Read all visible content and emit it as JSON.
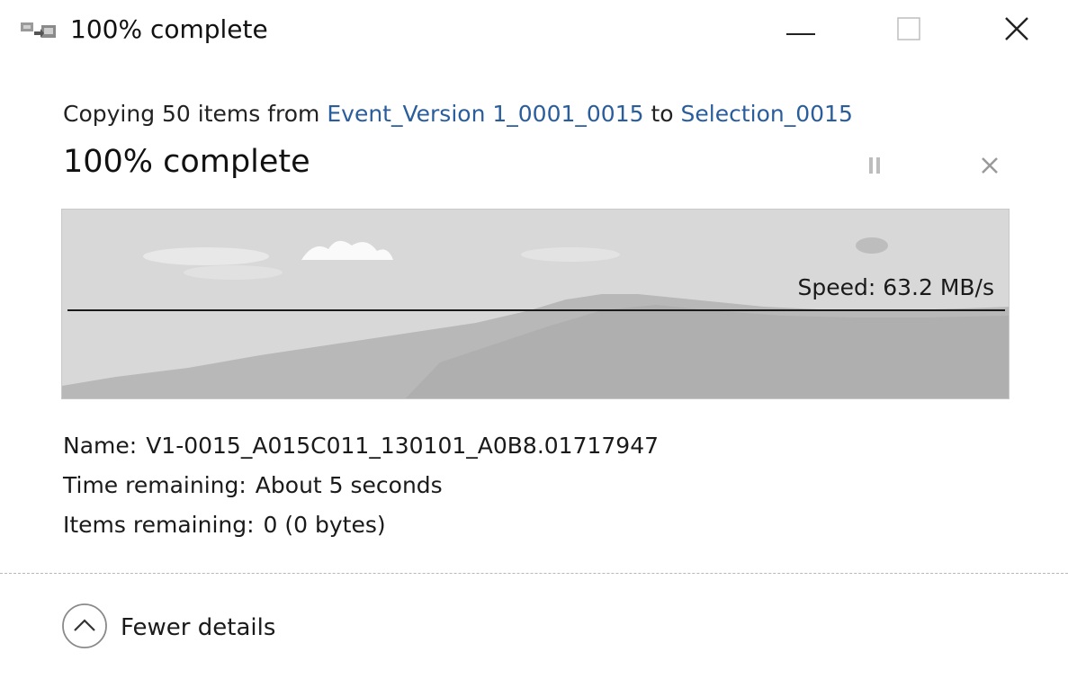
{
  "window": {
    "title": "100% complete",
    "icon": "copy-files-icon",
    "controls": {
      "minimize": "minimize-icon",
      "maximize": "maximize-icon",
      "close": "close-icon"
    }
  },
  "operation": {
    "prefix": "Copying 50 items from ",
    "source": "Event_Version 1_0001_0015",
    "mid": " to ",
    "destination": "Selection_0015",
    "status": "100% complete",
    "progress_fraction": 1.0,
    "pause_icon": "pause-icon",
    "cancel_icon": "close-icon"
  },
  "graph": {
    "speed": "Speed: 63.2 MB/s",
    "fill_color": "#b8b8b8",
    "background_color": "#d6d6d6"
  },
  "details": {
    "name_label": "Name:",
    "name_value": "V1-0015_A015C011_130101_A0B8.01717947",
    "time_label": "Time remaining:",
    "time_value": "About 5 seconds",
    "items_label": "Items remaining:",
    "items_value": "0 (0 bytes)"
  },
  "footer": {
    "toggle_label": "Fewer details",
    "toggle_icon": "chevron-up-circle-icon"
  }
}
